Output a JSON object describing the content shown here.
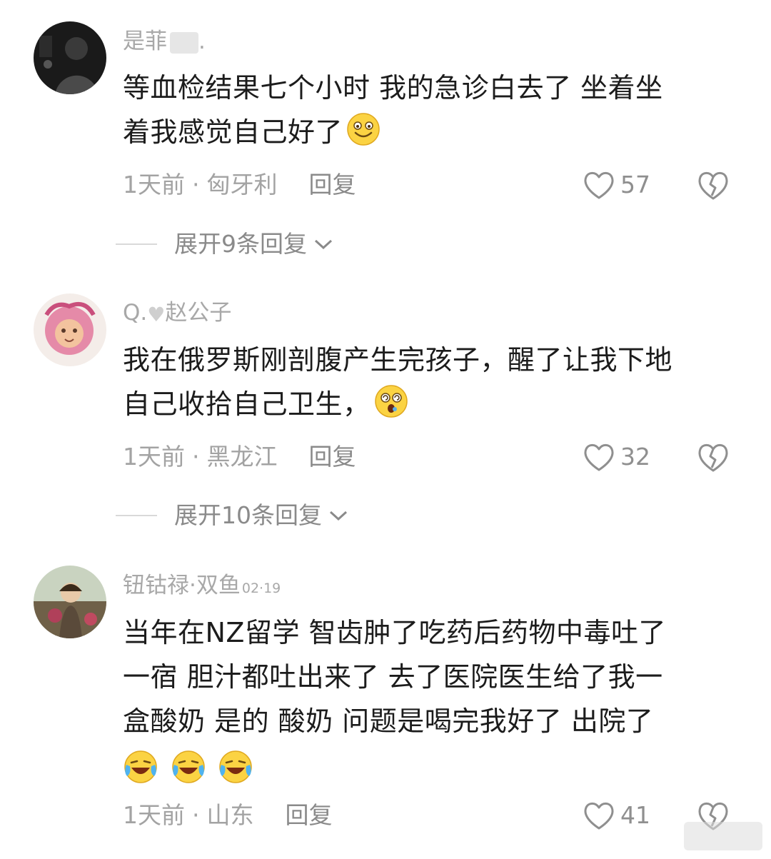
{
  "comments": [
    {
      "username": "是菲",
      "username_suffix": ".",
      "text_lines": [
        "等血检结果七个小时 我的急诊白去了 坐着坐",
        "着我感觉自己好了"
      ],
      "emoji_icons": [
        "grinning-face-icon"
      ],
      "time": "1天前",
      "location": "匈牙利",
      "reply_label": "回复",
      "likes": "57",
      "expand_label": "展开9条回复"
    },
    {
      "username_prefix": "Q.",
      "username": "赵公子",
      "text_lines": [
        "我在俄罗斯刚剖腹产生完孩子，醒了让我下地",
        "自己收拾自己卫生，"
      ],
      "emoji_icons": [
        "dizzy-face-icon"
      ],
      "time": "1天前",
      "location": "黑龙江",
      "reply_label": "回复",
      "likes": "32",
      "expand_label": "展开10条回复"
    },
    {
      "username": "钮钴禄·双鱼",
      "username_time": "02·19",
      "text_lines": [
        "当年在NZ留学 智齿肿了吃药后药物中毒吐了",
        "一宿 胆汁都吐出来了 去了医院医生给了我一",
        "盒酸奶 是的 酸奶 问题是喝完我好了 出院了"
      ],
      "emoji_icons": [
        "crying-laughing-icon",
        "crying-laughing-icon",
        "crying-laughing-icon"
      ],
      "time": "1天前",
      "location": "山东",
      "reply_label": "回复",
      "likes": "41"
    }
  ],
  "dot": "·",
  "colors": {
    "meta": "#a3a3a3",
    "text": "#1c1c1c",
    "emoji_yellow": "#fbd343"
  }
}
